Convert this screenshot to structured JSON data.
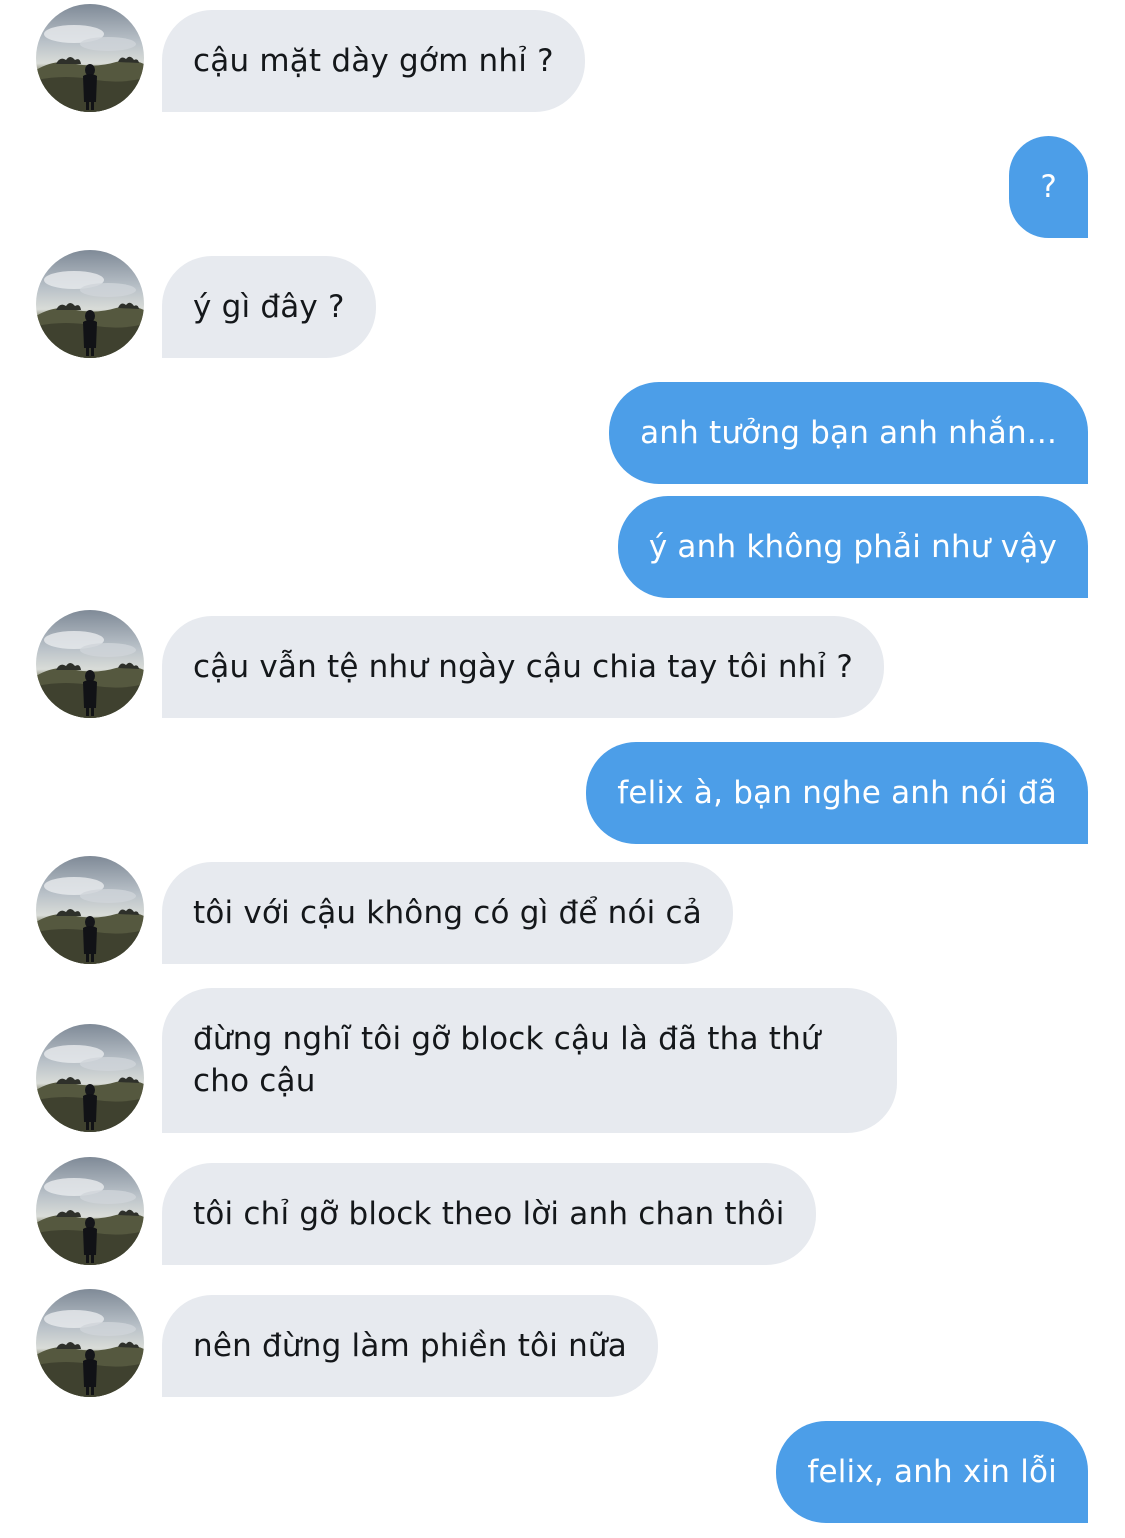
{
  "conversation": {
    "colors": {
      "incoming_bubble": "#e7eaef",
      "incoming_text": "#14171a",
      "outgoing_bubble": "#4c9ee8",
      "outgoing_text": "#ffffff"
    },
    "avatar": {
      "icon": "profile-photo-icon",
      "description_visible": false
    },
    "messages": [
      {
        "direction": "in",
        "text": "cậu mặt dày gớm nhỉ ?"
      },
      {
        "direction": "out",
        "text": "?"
      },
      {
        "direction": "in",
        "text": "ý gì đây ?"
      },
      {
        "direction": "out",
        "text": "anh tưởng bạn anh nhắn..."
      },
      {
        "direction": "out",
        "text": "ý anh không phải như vậy"
      },
      {
        "direction": "in",
        "text": "cậu vẫn tệ như ngày cậu chia tay tôi nhỉ ?"
      },
      {
        "direction": "out",
        "text": "felix à, bạn nghe anh nói đã"
      },
      {
        "direction": "in",
        "text": "tôi với cậu không có gì để nói cả"
      },
      {
        "direction": "in",
        "text": "đừng nghĩ tôi gỡ block cậu là đã tha thứ cho cậu"
      },
      {
        "direction": "in",
        "text": "tôi chỉ gỡ block theo lời anh chan thôi"
      },
      {
        "direction": "in",
        "text": "nên đừng làm phiền tôi nữa"
      },
      {
        "direction": "out",
        "text": "felix, anh xin lỗi"
      }
    ]
  }
}
